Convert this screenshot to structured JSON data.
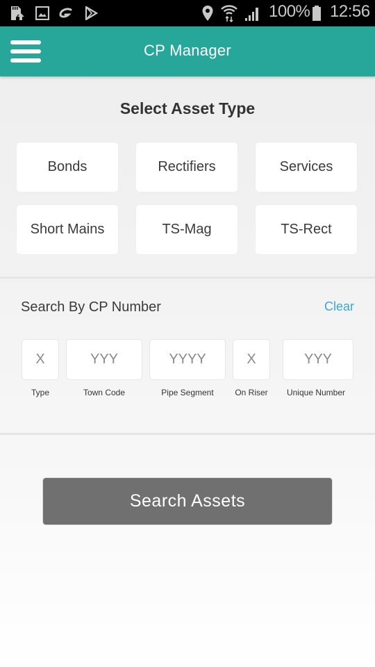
{
  "status_bar": {
    "left_icons": [
      "sd-card-upload-icon",
      "gallery-icon",
      "g-app-icon",
      "play-store-icon"
    ],
    "right_icons": [
      "location-icon",
      "wifi-icon",
      "signal-icon",
      "battery-icon"
    ],
    "battery": "100%",
    "time": "12:56"
  },
  "app_bar": {
    "title": "CP Manager",
    "menu_icon": "hamburger-menu-icon",
    "color": "#27a69a"
  },
  "asset_type": {
    "title": "Select Asset Type",
    "options": [
      {
        "label": "Bonds"
      },
      {
        "label": "Rectifiers"
      },
      {
        "label": "Services"
      },
      {
        "label": "Short Mains"
      },
      {
        "label": "TS-Mag"
      },
      {
        "label": "TS-Rect"
      }
    ]
  },
  "cp_search": {
    "title": "Search By CP Number",
    "clear_label": "Clear",
    "clear_color": "#3aa8d8",
    "fields": [
      {
        "placeholder": "X",
        "value": "",
        "caption": "Type"
      },
      {
        "placeholder": "YYY",
        "value": "",
        "caption": "Town Code"
      },
      {
        "placeholder": "YYYY",
        "value": "",
        "caption": "Pipe Segment"
      },
      {
        "placeholder": "X",
        "value": "",
        "caption": "On Riser"
      },
      {
        "placeholder": "YYY",
        "value": "",
        "caption": "Unique Number"
      }
    ]
  },
  "actions": {
    "search_label": "Search Assets"
  }
}
